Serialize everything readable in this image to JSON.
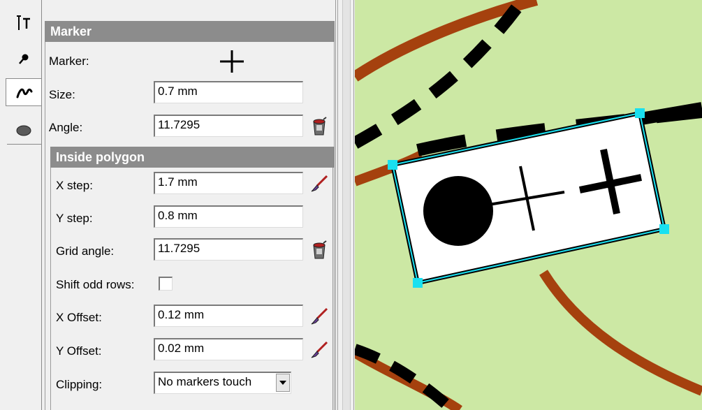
{
  "marker_section": {
    "title": "Marker",
    "marker_label": "Marker:",
    "size_label": "Size:",
    "size_value": "0.7 mm",
    "angle_label": "Angle:",
    "angle_value": "11.7295"
  },
  "inside_polygon": {
    "title": "Inside polygon",
    "x_step_label": "X step:",
    "x_step_value": "1.7 mm",
    "y_step_label": "Y step:",
    "y_step_value": "0.8 mm",
    "grid_angle_label": "Grid angle:",
    "grid_angle_value": "11.7295",
    "shift_odd_rows_label": "Shift odd rows:",
    "shift_odd_rows_checked": false,
    "x_offset_label": "X Offset:",
    "x_offset_value": "0.12 mm",
    "y_offset_label": "Y Offset:",
    "y_offset_value": "0.02 mm",
    "clipping_label": "Clipping:",
    "clipping_value": "No markers touch"
  },
  "tabs": [
    {
      "icon": "text-tool-icon"
    },
    {
      "icon": "pin-icon"
    },
    {
      "icon": "line-squiggle-icon"
    },
    {
      "icon": "area-blob-icon"
    }
  ],
  "colors": {
    "map_background": "#cce8a4",
    "path_brown": "#a5410e",
    "selection_handle": "#19e0f0",
    "section_header": "#8c8c8c"
  }
}
